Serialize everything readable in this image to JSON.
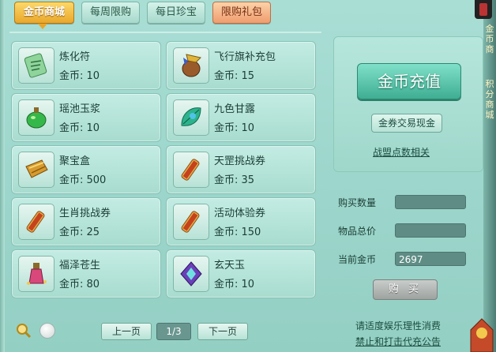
{
  "tabs": [
    {
      "label": "金币商城"
    },
    {
      "label": "每周限购"
    },
    {
      "label": "每日珍宝"
    },
    {
      "label": "限购礼包"
    }
  ],
  "items": [
    {
      "name": "炼化符",
      "price": "金币: 10",
      "icon": "talisman-icon"
    },
    {
      "name": "飞行旗补充包",
      "price": "金币: 15",
      "icon": "flag-pack-icon"
    },
    {
      "name": "瑶池玉浆",
      "price": "金币: 10",
      "icon": "jade-gourd-icon"
    },
    {
      "name": "九色甘露",
      "price": "金币: 10",
      "icon": "nectar-leaf-icon"
    },
    {
      "name": "聚宝盒",
      "price": "金币: 500",
      "icon": "treasure-box-icon"
    },
    {
      "name": "天罡挑战券",
      "price": "金币: 35",
      "icon": "scroll-icon"
    },
    {
      "name": "生肖挑战券",
      "price": "金币: 25",
      "icon": "scroll-icon"
    },
    {
      "name": "活动体验券",
      "price": "金币: 150",
      "icon": "scroll-icon"
    },
    {
      "name": "福泽苍生",
      "price": "金币: 80",
      "icon": "potion-icon"
    },
    {
      "name": "玄天玉",
      "price": "金币: 10",
      "icon": "gem-icon"
    }
  ],
  "right": {
    "recharge_label": "金币充值",
    "exchange_label": "金券交易现金",
    "alliance_link": "战盟点数相关",
    "qty_label": "购买数量",
    "total_label": "物品总价",
    "gold_label": "当前金币",
    "qty_value": "",
    "total_value": "",
    "gold_value": "2697",
    "buy_label": "购 买",
    "notice1": "请适度娱乐理性消费",
    "notice2": "禁止和打击代充公告"
  },
  "pager": {
    "prev": "上一页",
    "page": "1/3",
    "next": "下一页"
  },
  "side": {
    "text1": "金币商",
    "text2": "积分商城"
  },
  "colors": {
    "accent": "#e9a72a",
    "panel": "#9dd6cc",
    "field": "#5f8d86"
  }
}
